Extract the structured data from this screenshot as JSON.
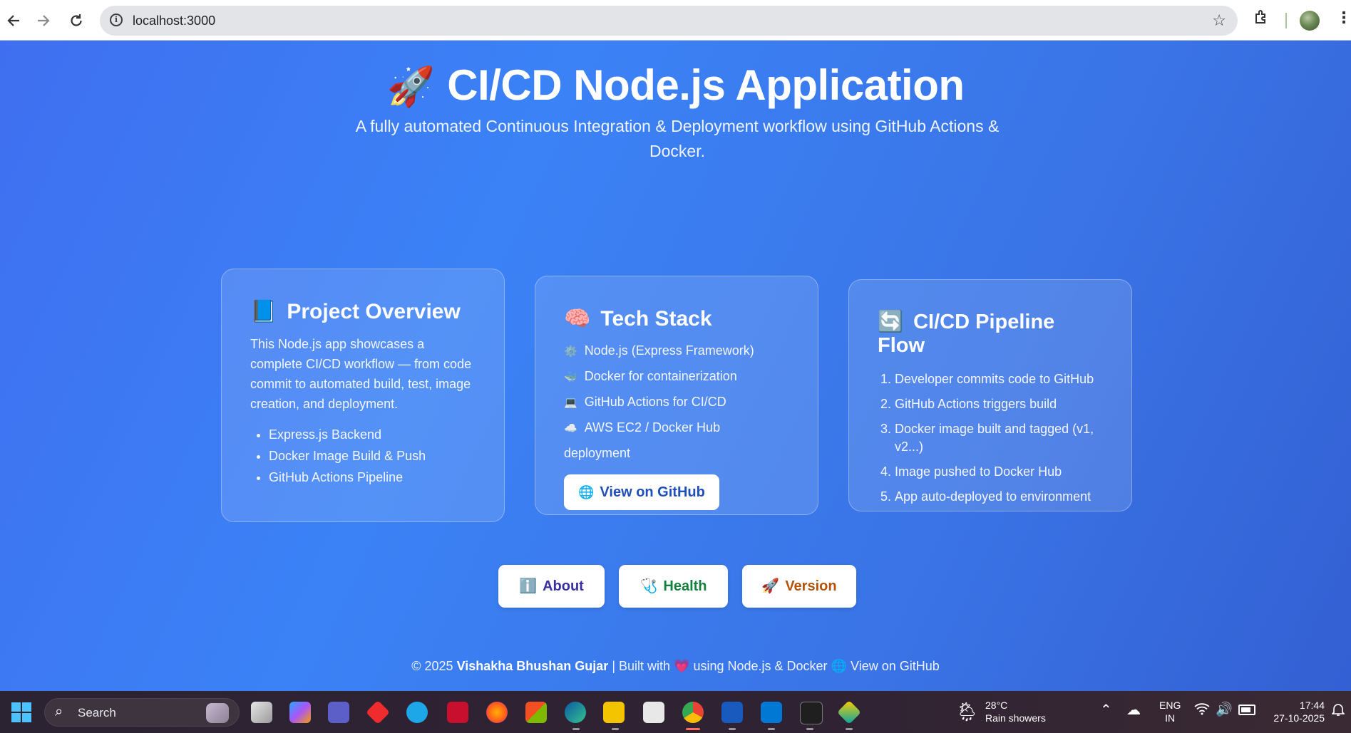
{
  "browser": {
    "url": "localhost:3000",
    "icons": [
      "back-arrow-icon",
      "forward-arrow-icon",
      "reload-icon",
      "site-info-icon",
      "bookmark-star-icon",
      "extensions-icon",
      "profile-avatar"
    ]
  },
  "hero": {
    "emoji": "🚀",
    "title": "CI/CD Node.js Application",
    "subtitle": "A fully automated Continuous Integration & Deployment workflow using GitHub Actions & Docker."
  },
  "overview": {
    "emoji": "📘",
    "title": "Project Overview",
    "description": "This Node.js app showcases a complete CI/CD workflow — from code commit to automated build, test, image creation, and deployment.",
    "items": [
      "Express.js Backend",
      "Docker Image Build & Push",
      "GitHub Actions Pipeline"
    ]
  },
  "stack": {
    "emoji": "🧠",
    "title": "Tech Stack",
    "items": [
      {
        "emoji": "⚙️",
        "text": "Node.js (Express Framework)"
      },
      {
        "emoji": "🐳",
        "text": "Docker for containerization"
      },
      {
        "emoji": "💻",
        "text": "GitHub Actions for CI/CD"
      },
      {
        "emoji": "☁️",
        "text": "AWS EC2 / Docker Hub deployment"
      }
    ],
    "github_button": {
      "emoji": "🌐",
      "label": "View on GitHub"
    }
  },
  "pipeline": {
    "emoji": "🔄",
    "title": "CI/CD Pipeline Flow",
    "steps": [
      "Developer commits code to GitHub",
      "GitHub Actions triggers build",
      "Docker image built and tagged (v1, v2...)",
      "Image pushed to Docker Hub",
      "App auto-deployed to environment"
    ]
  },
  "actions": [
    {
      "emoji": "ℹ️",
      "label": "About",
      "color": "#3730a3"
    },
    {
      "emoji": "🩺",
      "label": "Health",
      "color": "#15803d"
    },
    {
      "emoji": "🚀",
      "label": "Version",
      "color": "#b45309"
    }
  ],
  "footer": {
    "copyright": "© 2025",
    "author": "Vishakha Bhushan Gujar",
    "built_with": "| Built with",
    "heart": "💗",
    "using": "using Node.js & Docker",
    "globe": "🌐",
    "link": "View on GitHub"
  },
  "taskbar": {
    "search_label": "Search",
    "weather": {
      "temp": "28°C",
      "condition": "Rain showers"
    },
    "language": {
      "lang": "ENG",
      "region": "IN"
    },
    "time": "17:44",
    "date": "27-10-2025"
  }
}
